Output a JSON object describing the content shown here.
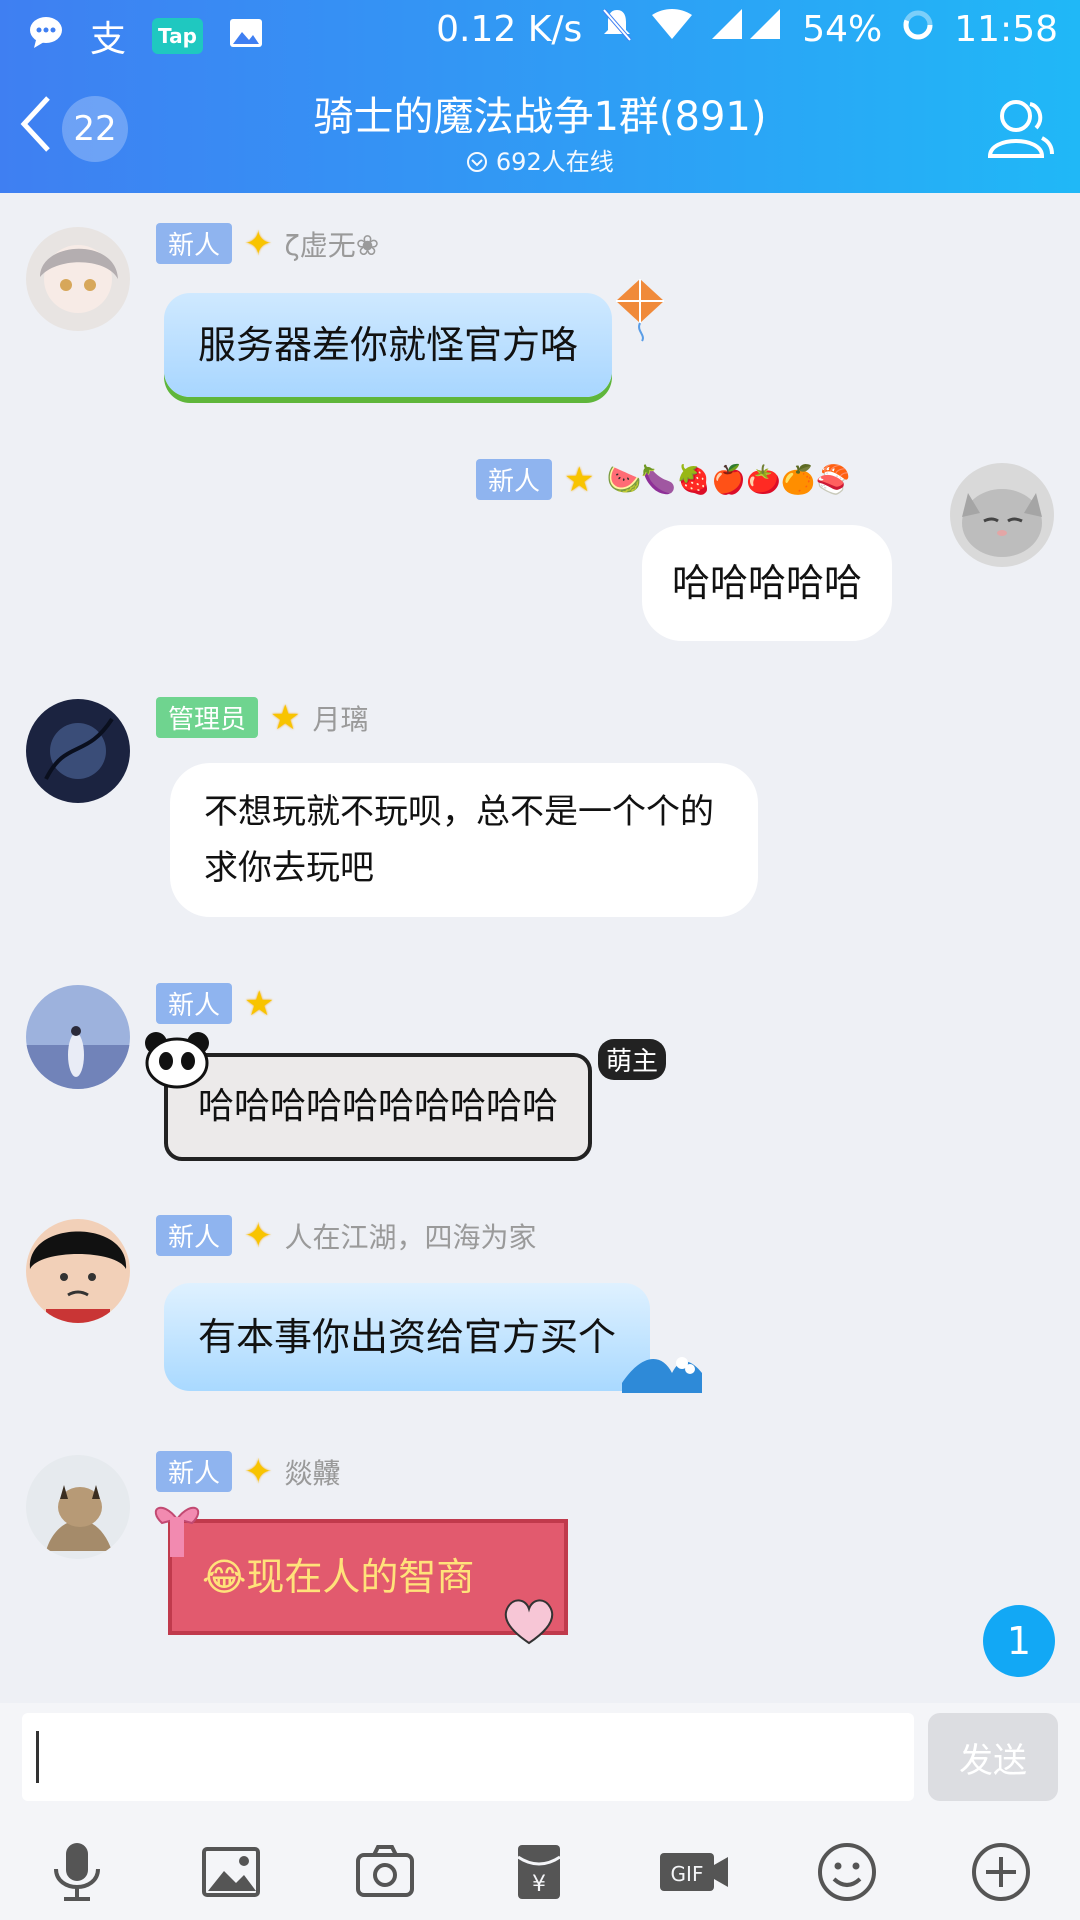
{
  "status_bar": {
    "app_icon_text": "支",
    "tap_label": "Tap",
    "speed": "0.12 K/s",
    "battery": "54%",
    "time": "11:58"
  },
  "header": {
    "back_count": "22",
    "title": "骑士的魔法战争1群(891)",
    "online": "692人在线"
  },
  "messages": [
    {
      "tag": "新人",
      "name": "ζ虚无❀",
      "text": "服务器差你就怪官方咯"
    },
    {
      "tag": "新人",
      "name": "🍉🍆🍓🍎🍅🍊🍣",
      "text": "哈哈哈哈哈"
    },
    {
      "tag": "管理员",
      "name": "月璃",
      "text": "不想玩就不玩呗，总不是一个个的求你去玩吧"
    },
    {
      "tag": "新人",
      "name": "",
      "text": "哈哈哈哈哈哈哈哈哈哈",
      "bubble_badge": "萌主"
    },
    {
      "tag": "新人",
      "name": "人在江湖，四海为家",
      "text": "有本事你出资给官方买个"
    },
    {
      "tag": "新人",
      "name": "燚齉",
      "text": "😂现在人的智商"
    }
  ],
  "unread_count": "1",
  "input": {
    "value": "",
    "send_label": "发送"
  },
  "colors": {
    "header_start": "#3f7ff2",
    "header_end": "#20b8f7",
    "unread": "#12a8f5"
  }
}
